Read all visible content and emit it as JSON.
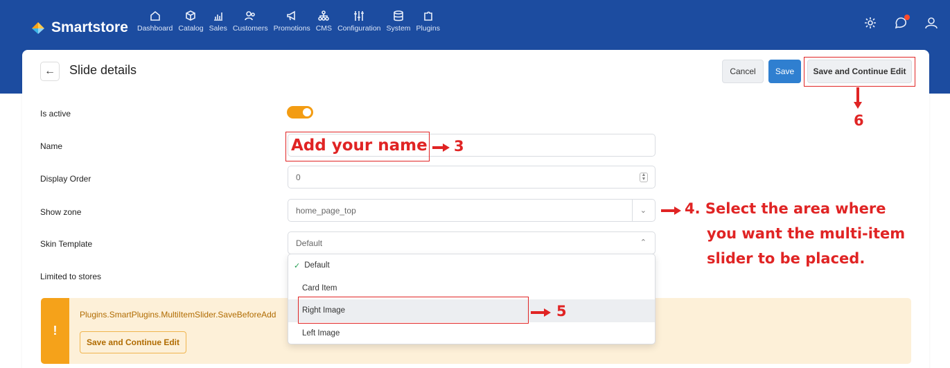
{
  "brand": {
    "name": "Smartstore"
  },
  "nav": [
    {
      "label": "Dashboard",
      "icon": "home-icon"
    },
    {
      "label": "Catalog",
      "icon": "box-icon"
    },
    {
      "label": "Sales",
      "icon": "chart-icon"
    },
    {
      "label": "Customers",
      "icon": "users-icon"
    },
    {
      "label": "Promotions",
      "icon": "megaphone-icon"
    },
    {
      "label": "CMS",
      "icon": "sitemap-icon"
    },
    {
      "label": "Configuration",
      "icon": "sliders-icon"
    },
    {
      "label": "System",
      "icon": "database-icon"
    },
    {
      "label": "Plugins",
      "icon": "puzzle-icon"
    }
  ],
  "header": {
    "title": "Slide details",
    "cancel": "Cancel",
    "save": "Save",
    "save_continue": "Save and Continue Edit"
  },
  "form": {
    "is_active_label": "Is active",
    "is_active": true,
    "name_label": "Name",
    "name_value": "",
    "display_order_label": "Display Order",
    "display_order_value": "0",
    "show_zone_label": "Show zone",
    "show_zone_value": "home_page_top",
    "skin_template_label": "Skin Template",
    "skin_template_value": "Default",
    "limited_stores_label": "Limited to stores"
  },
  "dropdown": {
    "options": [
      "Default",
      "Card Item",
      "Right Image",
      "Left Image"
    ],
    "selected": "Default",
    "highlighted": "Right Image"
  },
  "alert": {
    "message": "Plugins.SmartPlugins.MultiItemSlider.SaveBeforeAdd",
    "button": "Save and Continue Edit",
    "icon": "!"
  },
  "annotations": {
    "name_hint": "Add your name",
    "step3": "3",
    "step4": "4. Select the area where",
    "step4_line2": "you want the multi-item",
    "step4_line3": "slider to be placed.",
    "step5": "5",
    "step6": "6"
  },
  "colors": {
    "topbar": "#1c4ca0",
    "primary": "#2f7fd0",
    "toggle": "#f39c12",
    "annotation": "#e02424",
    "alert_bg": "#fdf0d8"
  }
}
